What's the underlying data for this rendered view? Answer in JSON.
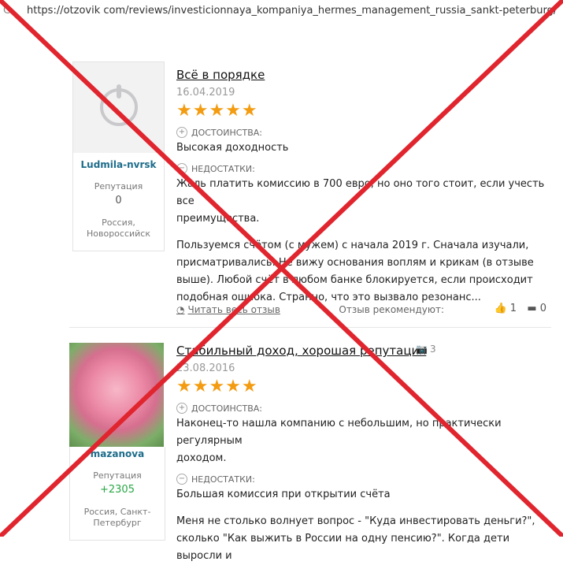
{
  "browser": {
    "url": "https://otzovik com/reviews/investicionnaya_kompaniya_hermes_management_russia_sankt-peterburg/"
  },
  "review1": {
    "user": "Ludmila-nvrsk",
    "reputation_label": "Репутация",
    "reputation_value": "0",
    "location": "Россия, Новороссийск",
    "title": "Всё в порядке",
    "date": "16.04.2019",
    "rating": 5,
    "pros_label": "ДОСТОИНСТВА:",
    "pros": "Высокая доходность",
    "cons_label": "НЕДОСТАТКИ:",
    "cons_line1": "Жаль платить комиссию в 700 евро, но оно того стоит, если учесть все",
    "cons_line2": "преимущества.",
    "body_line1": "Пользуемся счётом (с мужем) с начала 2019 г. Сначала изучали,",
    "body_line2": "присматривались. Не вижу основания воплям и крикам (в отзыве",
    "body_line3": "выше). Любой счёт в любом банке блокируется, если происходит",
    "body_line4": "подобная ошибка. Странно, что это вызвало резонанс...",
    "read_more": "Читать весь отзыв",
    "recommend_label": "Отзыв рекомендуют:",
    "likes": "1",
    "comments": "0"
  },
  "review2": {
    "user": "mazanova",
    "reputation_label": "Репутация",
    "reputation_value": "+2305",
    "location": "Россия, Санкт-Петербург",
    "title": "Стабильный доход, хорошая репутация",
    "photo_count": "3",
    "date": "23.08.2016",
    "rating": 5,
    "pros_label": "ДОСТОИНСТВА:",
    "pros_line1": "Наконец-то нашла компанию с небольшим, но практически регулярным",
    "pros_line2": "доходом.",
    "cons_label": "НЕДОСТАТКИ:",
    "cons": "Большая комиссия при открытии счёта",
    "body_line1": "Меня не столько волнует вопрос - \"Куда инвестировать деньги?\",",
    "body_line2": "сколько \"Как выжить в России на одну пенсию?\". Когда дети выросли и"
  },
  "stars_text": "★★★★★",
  "overlay": {
    "color": "#e0252e"
  }
}
